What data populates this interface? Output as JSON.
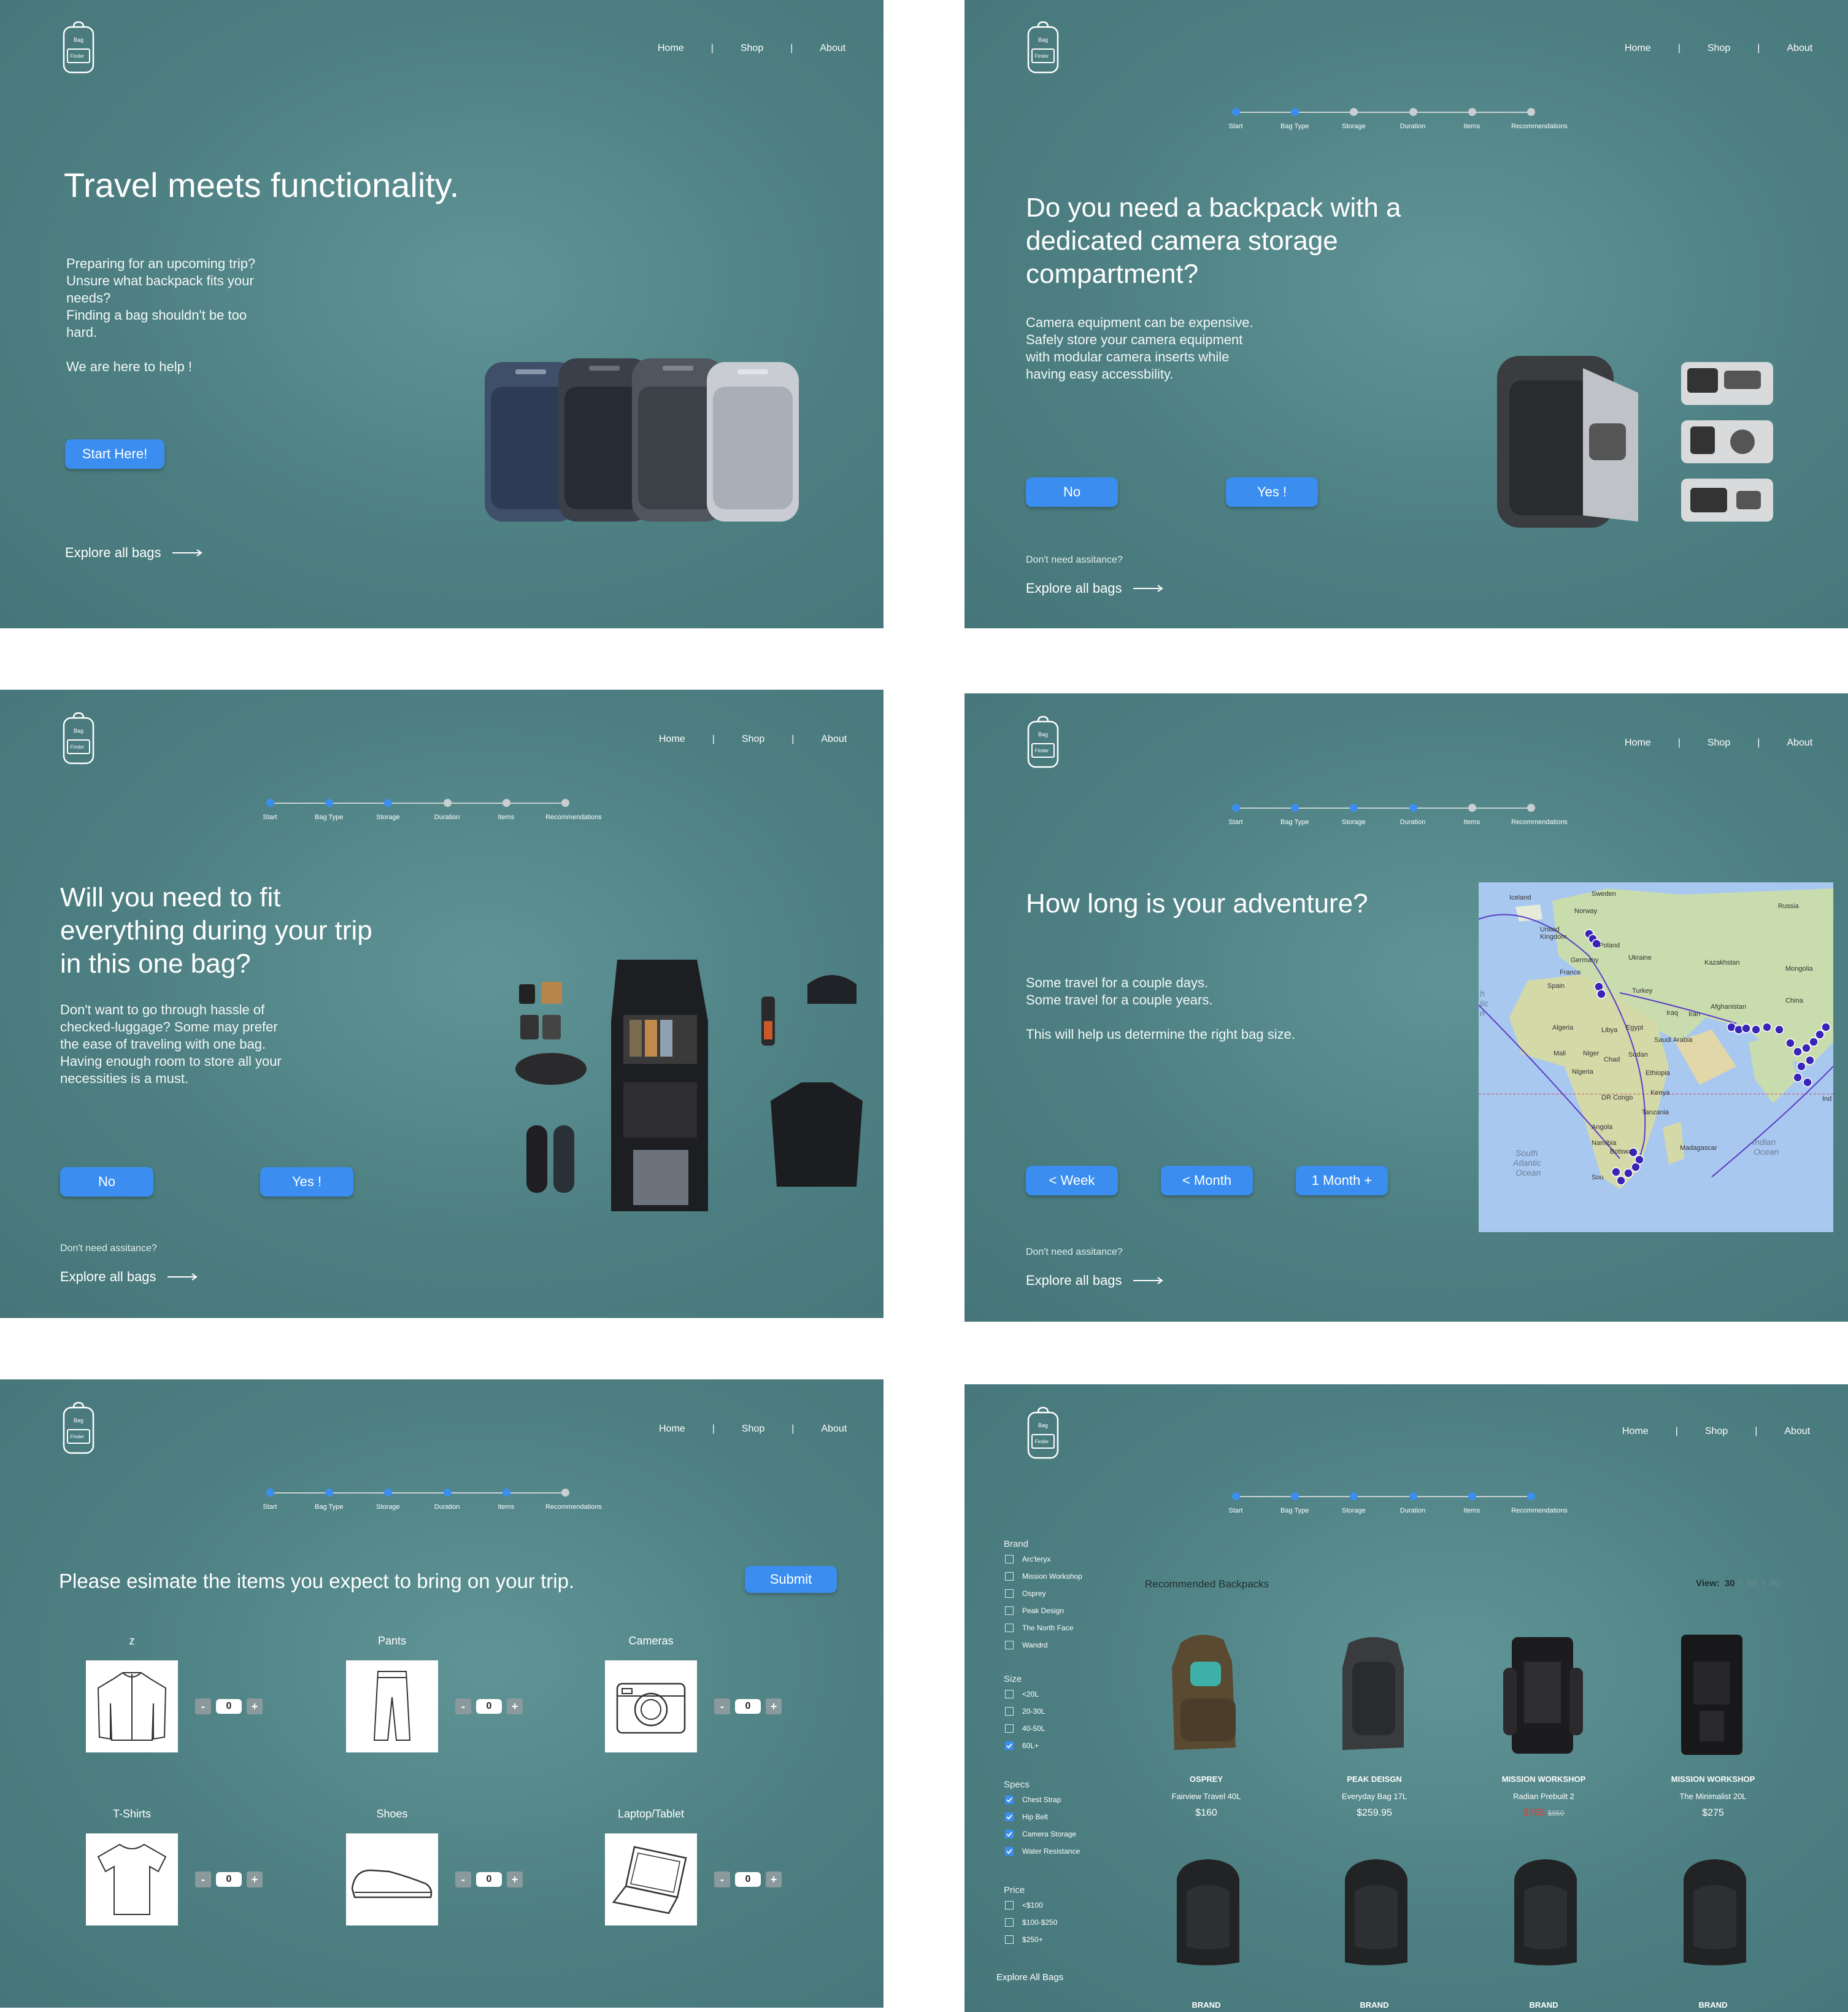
{
  "nav": {
    "home": "Home",
    "shop": "Shop",
    "about": "About",
    "sep": "|"
  },
  "logo": {
    "line1": "Bag",
    "line2": "Finder"
  },
  "steps": [
    "Start",
    "Bag Type",
    "Storage",
    "Duration",
    "Items",
    "Recommendations"
  ],
  "common": {
    "explore": "Explore all bags",
    "dont_need": "Don't need assitance?"
  },
  "panel1": {
    "title": "Travel meets functionality.",
    "body": "Preparing for an upcoming trip?\nUnsure what backpack fits your\nneeds?\nFinding a bag shouldn't be too\nhard.\n\nWe are here to help !",
    "cta": "Start Here!"
  },
  "panel2": {
    "question": "Do you need a backpack with a\ndedicated camera storage\ncompartment?",
    "body": "Camera equipment can be expensive.\nSafely store your camera equipment\nwith modular camera inserts while\nhaving easy accessbility.",
    "no": "No",
    "yes": "Yes !"
  },
  "panel3": {
    "question": "Will you need to fit\neverything during your trip\nin this one bag?",
    "body": "Don't want to go through hassle of\nchecked-luggage? Some may prefer\nthe ease of traveling with one bag.\nHaving enough room to store all your\nnecessities is a must.",
    "no": "No",
    "yes": "Yes !"
  },
  "panel4": {
    "question": "How long is your adventure?",
    "body": "Some travel for a couple days.\nSome travel for a couple years.\n\nThis will help us determine the right bag size.",
    "opt1": "< Week",
    "opt2": "< Month",
    "opt3": "1 Month +",
    "map_labels": {
      "iceland": "Iceland",
      "sweden": "Sweden",
      "norway": "Norway",
      "russia": "Russia",
      "uk": "United\nKingdom",
      "poland": "Poland",
      "germany": "Germany",
      "ukraine": "Ukraine",
      "kazakhstan": "Kazakhstan",
      "mongolia": "Mongolia",
      "france": "France",
      "spain": "Spain",
      "turkey": "Turkey",
      "china": "China",
      "algeria": "Algeria",
      "libya": "Libya",
      "egypt": "Egypt",
      "iraq": "Iraq",
      "iran": "Iran",
      "afghanistan": "Afghanistan",
      "saudi": "Saudi Arabia",
      "mali": "Mali",
      "niger": "Niger",
      "chad": "Chad",
      "sudan": "Sudan",
      "nigeria": "Nigeria",
      "ethiopia": "Ethiopia",
      "drc": "DR Congo",
      "kenya": "Kenya",
      "tanzania": "Tanzania",
      "angola": "Angola",
      "namibia": "Namibia",
      "botswana": "Botswa",
      "madagascar": "Madagascar",
      "southatl": "South\nAtlantic\nOcean",
      "indian": "Indian\nOcean",
      "atlantic_frag": "h\ntic\nn",
      "sou": "Sou",
      "ind": "Ind"
    }
  },
  "panel5": {
    "prompt": "Please esimate the items you expect to bring on your trip.",
    "submit": "Submit",
    "items": [
      {
        "label": "z",
        "count": "0",
        "icon": "jacket-icon"
      },
      {
        "label": "Pants",
        "count": "0",
        "icon": "pants-icon"
      },
      {
        "label": "Cameras",
        "count": "0",
        "icon": "camera-icon"
      },
      {
        "label": "T-Shirts",
        "count": "0",
        "icon": "tshirt-icon"
      },
      {
        "label": "Shoes",
        "count": "0",
        "icon": "shoe-icon"
      },
      {
        "label": "Laptop/Tablet",
        "count": "0",
        "icon": "laptop-icon"
      }
    ],
    "minus": "-",
    "plus": "+"
  },
  "panel6": {
    "filters": {
      "brand": {
        "title": "Brand",
        "options": [
          {
            "label": "Arc'teryx",
            "checked": false
          },
          {
            "label": "Mission Workshop",
            "checked": false
          },
          {
            "label": "Osprey",
            "checked": false
          },
          {
            "label": "Peak Design",
            "checked": false
          },
          {
            "label": "The North Face",
            "checked": false
          },
          {
            "label": "Wandrd",
            "checked": false
          }
        ]
      },
      "size": {
        "title": "Size",
        "options": [
          {
            "label": "<20L",
            "checked": false
          },
          {
            "label": "20-30L",
            "checked": false
          },
          {
            "label": "40-50L",
            "checked": false
          },
          {
            "label": "60L+",
            "checked": true
          }
        ]
      },
      "specs": {
        "title": "Specs",
        "options": [
          {
            "label": "Chest Strap",
            "checked": true
          },
          {
            "label": "Hip Belt",
            "checked": true
          },
          {
            "label": "Camera Storage",
            "checked": true
          },
          {
            "label": "Water Resistance",
            "checked": true
          }
        ]
      },
      "price": {
        "title": "Price",
        "options": [
          {
            "label": "<$100",
            "checked": false
          },
          {
            "label": "$100-$250",
            "checked": false
          },
          {
            "label": "$250+",
            "checked": false
          }
        ]
      }
    },
    "explore_all": "Explore All Bags",
    "heading": "Recommended Backpacks",
    "view": {
      "label": "View:",
      "options": [
        "30",
        "60",
        "90"
      ],
      "active": "30",
      "sep": "|"
    },
    "products": [
      {
        "brand": "OSPREY",
        "name": "Fairview Travel 40L",
        "price": "$160",
        "old": ""
      },
      {
        "brand": "PEAK DEISGN",
        "name": "Everyday Bag 17L",
        "price": "$259.95",
        "old": ""
      },
      {
        "brand": "MISSION WORKSHOP",
        "name": "Radian Prebuilt 2",
        "price": "$765",
        "old": "$850"
      },
      {
        "brand": "MISSION WORKSHOP",
        "name": "The Minimalist 20L",
        "price": "$275",
        "old": ""
      }
    ],
    "row2_brand": "BRAND",
    "colors": {
      "sale": "#e0403a",
      "accent": "#3b8ef0"
    }
  }
}
